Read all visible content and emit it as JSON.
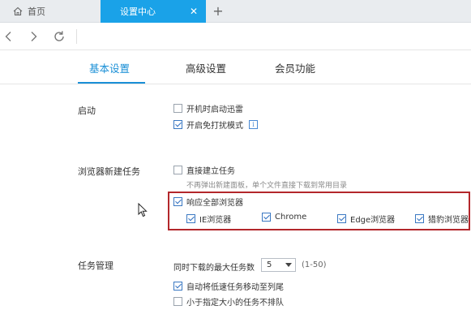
{
  "browser": {
    "tabs": [
      {
        "label": "首页",
        "icon": "home-icon"
      },
      {
        "label": "设置中心",
        "active": true
      }
    ],
    "close_glyph": "✕",
    "new_tab_glyph": "+"
  },
  "settings": {
    "tabs": [
      {
        "label": "基本设置",
        "active": true
      },
      {
        "label": "高级设置"
      },
      {
        "label": "会员功能"
      }
    ],
    "sections": {
      "startup": {
        "label": "启动",
        "options": [
          {
            "label": "开机时启动迅雷",
            "checked": false
          },
          {
            "label": "开启免打扰模式",
            "checked": true,
            "info_glyph": "i"
          }
        ]
      },
      "browser_task": {
        "label": "浏览器新建任务",
        "direct_create": {
          "label": "直接建立任务",
          "checked": false
        },
        "hint": "不再弹出新建面板，单个文件直接下载到常用目录",
        "respond_all": {
          "label": "响应全部浏览器",
          "checked": true
        },
        "browsers": [
          {
            "label": "IE浏览器",
            "checked": true
          },
          {
            "label": "Chrome",
            "checked": true
          },
          {
            "label": "Edge浏览器",
            "checked": true
          },
          {
            "label": "猎豹浏览器",
            "checked": true
          }
        ]
      },
      "task_manage": {
        "label": "任务管理",
        "max_tasks_label": "同时下载的最大任务数",
        "max_tasks_value": "5",
        "max_tasks_range": "(1-50)",
        "options": [
          {
            "label": "自动将低速任务移动至列尾",
            "checked": true
          },
          {
            "label": "小于指定大小的任务不排队",
            "checked": false
          }
        ]
      }
    }
  },
  "colors": {
    "accent": "#1aa2e8",
    "tab_active_text": "#1a8fd6",
    "highlight_border": "#b3272b"
  }
}
